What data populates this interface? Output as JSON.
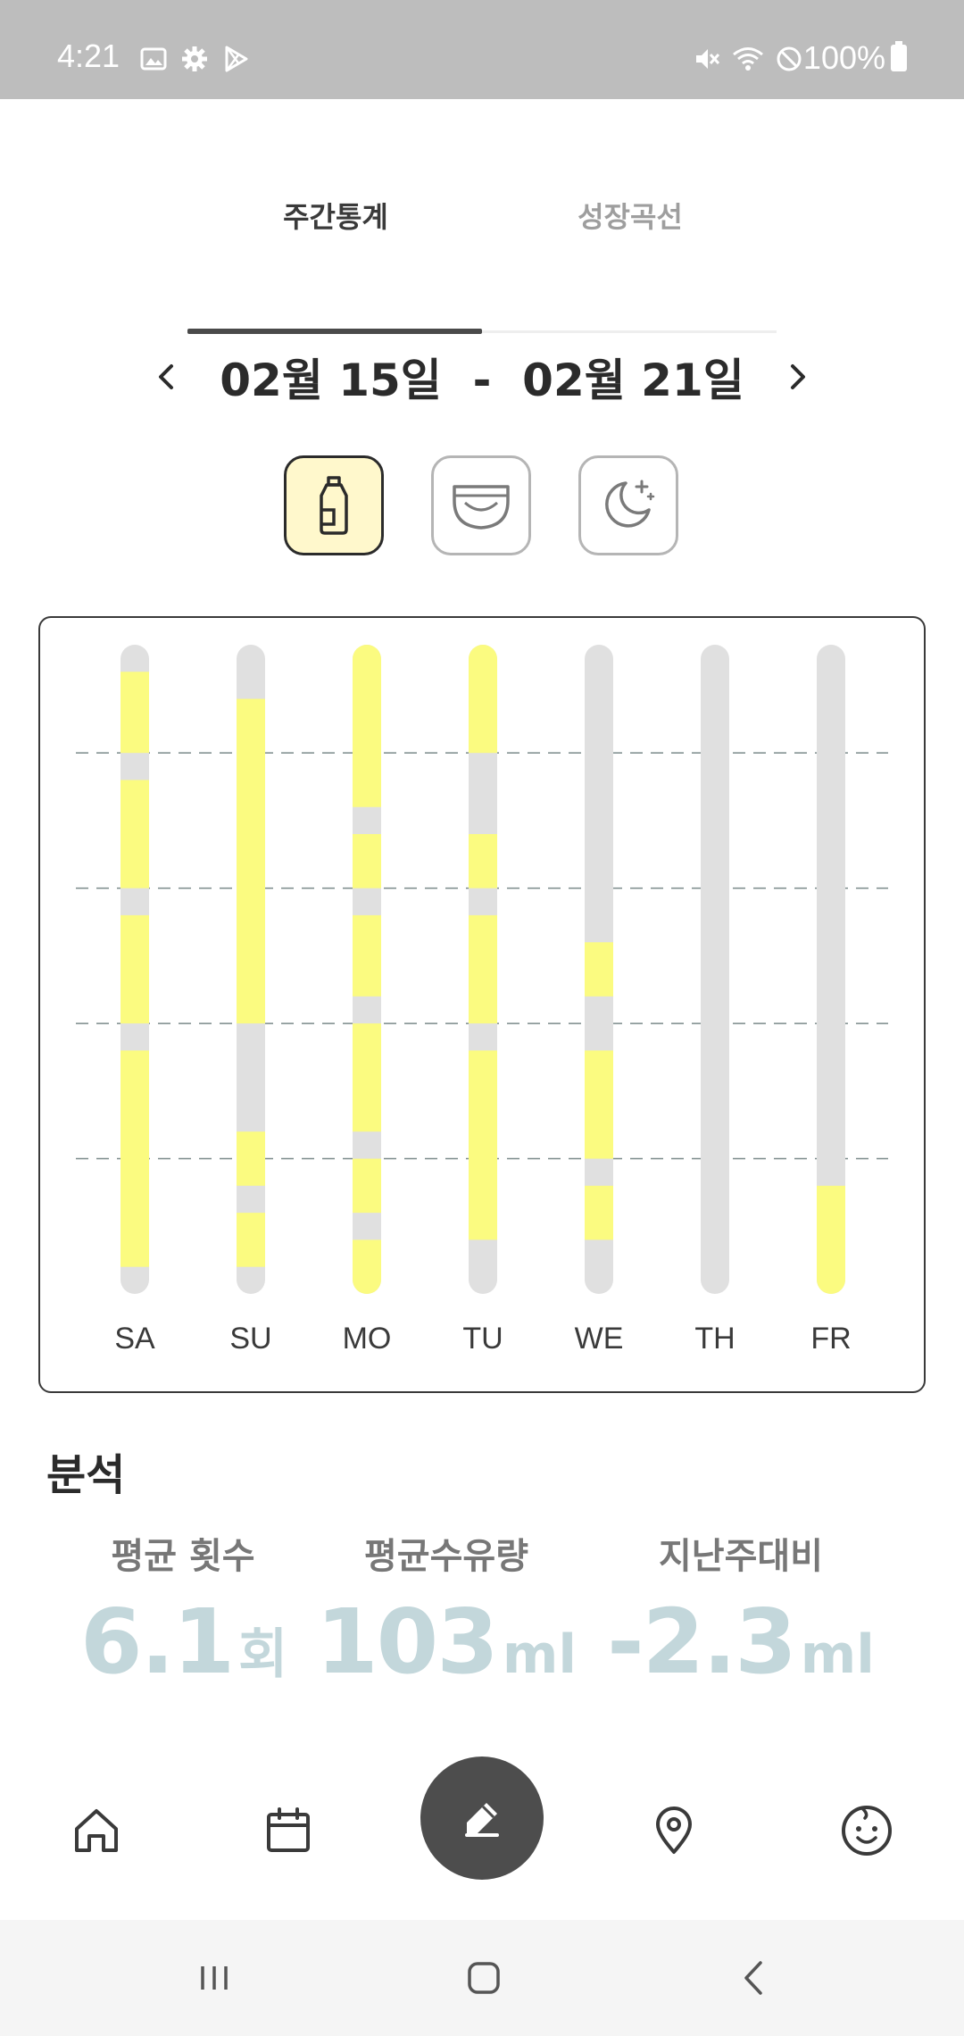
{
  "status_bar": {
    "time": "4:21",
    "battery": "100%",
    "left_icons": [
      "gallery-icon",
      "settings-icon",
      "play-store-icon"
    ],
    "right_icons": [
      "mute-icon",
      "wifi-icon",
      "do-not-disturb-icon",
      "battery-icon"
    ]
  },
  "tabs": [
    {
      "label": "주간통계",
      "active": true
    },
    {
      "label": "성장곡선",
      "active": false
    }
  ],
  "week": {
    "range": "02월 15일  -  02월 21일",
    "prev_icon": "chevron-left-icon",
    "next_icon": "chevron-right-icon"
  },
  "categories": [
    {
      "name": "feeding",
      "icon": "bottle-icon",
      "active": true
    },
    {
      "name": "diaper",
      "icon": "diaper-icon",
      "active": false
    },
    {
      "name": "sleep",
      "icon": "moon-icon",
      "active": false
    }
  ],
  "chart_data": {
    "type": "bar",
    "subtype": "24h-timeline",
    "categories": [
      "SA",
      "SU",
      "MO",
      "TU",
      "WE",
      "TH",
      "FR"
    ],
    "y_unit": "hour",
    "ylim": [
      0,
      24
    ],
    "gridlines": [
      4,
      9,
      14,
      19
    ],
    "colors": {
      "track": "#e0e0e0",
      "active": "#fbfb80",
      "grid": "#7a8a8a"
    },
    "series": [
      {
        "day": "SA",
        "segments": [
          [
            1,
            4
          ],
          [
            5,
            9
          ],
          [
            10,
            14
          ],
          [
            15,
            23
          ]
        ]
      },
      {
        "day": "SU",
        "segments": [
          [
            2,
            14
          ],
          [
            18,
            20
          ],
          [
            21,
            23
          ]
        ]
      },
      {
        "day": "MO",
        "segments": [
          [
            0,
            6
          ],
          [
            7,
            9
          ],
          [
            10,
            13
          ],
          [
            14,
            18
          ],
          [
            19,
            21
          ],
          [
            22,
            24
          ]
        ]
      },
      {
        "day": "TU",
        "segments": [
          [
            0,
            4
          ],
          [
            7,
            9
          ],
          [
            10,
            14
          ],
          [
            15,
            22
          ]
        ]
      },
      {
        "day": "WE",
        "segments": [
          [
            11,
            13
          ],
          [
            15,
            19
          ],
          [
            20,
            22
          ]
        ]
      },
      {
        "day": "TH",
        "segments": []
      },
      {
        "day": "FR",
        "segments": [
          [
            20,
            24
          ]
        ]
      }
    ]
  },
  "analysis": {
    "title": "분석",
    "stats": [
      {
        "label": "평균 횟수",
        "value": "6.1",
        "unit": "회"
      },
      {
        "label": "평균수유량",
        "value": "103",
        "unit": "ml"
      },
      {
        "label": "지난주대비",
        "value": "-2.3",
        "unit": "ml"
      }
    ]
  },
  "bottom_nav": [
    "home-icon",
    "calendar-icon",
    "edit-icon",
    "location-icon",
    "baby-icon"
  ],
  "system_nav": [
    "recent-apps-icon",
    "home-button-icon",
    "back-icon"
  ]
}
